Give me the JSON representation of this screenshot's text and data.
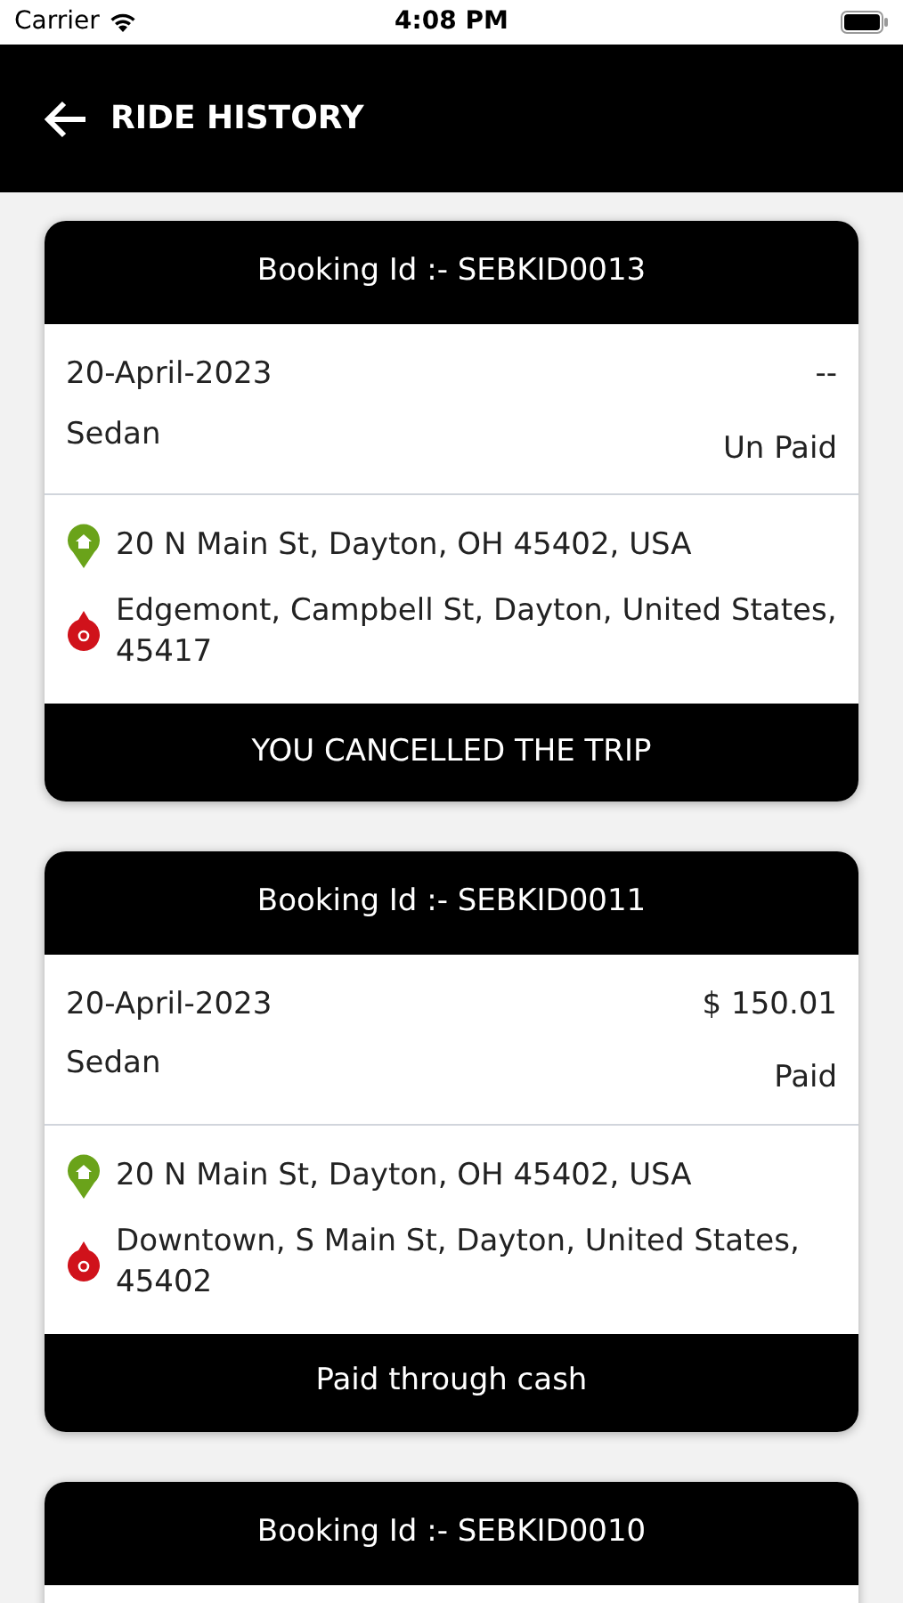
{
  "status_bar": {
    "carrier": "Carrier",
    "time": "4:08 PM"
  },
  "header": {
    "title": "RIDE HISTORY"
  },
  "bookings": [
    {
      "booking_id": "Booking Id :- SEBKID0013",
      "date": "20-April-2023",
      "amount": "--",
      "vehicle": "Sedan",
      "payment_status": "Un Paid",
      "pickup": "20 N Main St, Dayton, OH 45402, USA",
      "drop": "Edgemont, Campbell St, Dayton, United States, 45417",
      "footer": "YOU CANCELLED THE TRIP"
    },
    {
      "booking_id": "Booking Id :- SEBKID0011",
      "date": "20-April-2023",
      "amount": "$ 150.01",
      "vehicle": "Sedan",
      "payment_status": "Paid",
      "pickup": "20 N Main St, Dayton, OH 45402, USA",
      "drop": "Downtown, S Main St, Dayton, United States, 45402",
      "footer": "Paid through cash"
    },
    {
      "booking_id": "Booking Id :- SEBKID0010"
    }
  ]
}
